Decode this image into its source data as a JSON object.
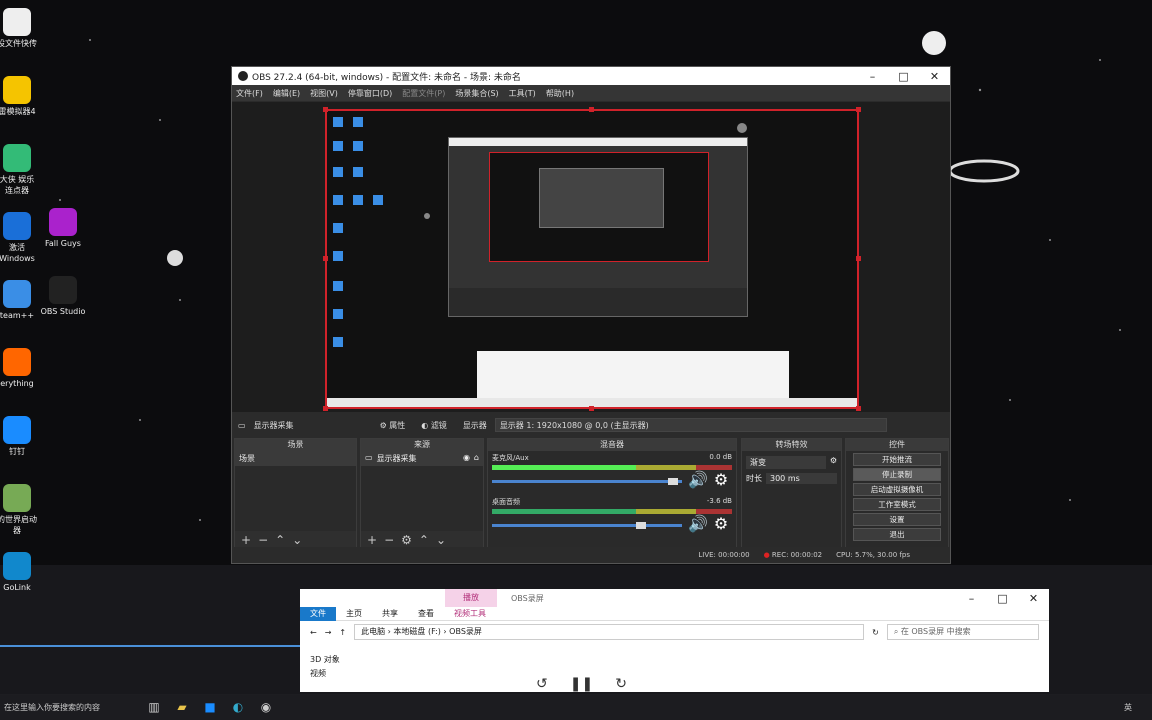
{
  "desktop_icons": [
    {
      "label": "设文件快传",
      "icon": "file-icon",
      "color": "#eee"
    },
    {
      "label": "雷模拟器4",
      "icon": "emulator-icon",
      "color": "#f5c400"
    },
    {
      "label": "大侠 娱乐\n连点器",
      "icon": "clicker-icon",
      "color": "#3b7"
    },
    {
      "label": "激活\nWindows",
      "icon": "zip-icon",
      "color": "#1a6fd8"
    },
    {
      "label": "team++",
      "icon": "gear-icon",
      "color": "#3a8ee6"
    },
    {
      "label": "erything",
      "icon": "search-icon",
      "color": "#f60"
    },
    {
      "label": "钉钉",
      "icon": "dingtalk-icon",
      "color": "#1a8cff"
    },
    {
      "label": "的世界启动\n器",
      "icon": "minecraft-icon",
      "color": "#7a5"
    },
    {
      "label": "GoLink",
      "icon": "golink-icon",
      "color": "#18c"
    }
  ],
  "desktop_icons2": [
    {
      "label": "Fall Guys",
      "icon": "fallguys-icon",
      "color": "#a2c"
    },
    {
      "label": "OBS Studio",
      "icon": "obs-icon",
      "color": "#222"
    }
  ],
  "obs": {
    "title": "OBS 27.2.4 (64-bit, windows) - 配置文件: 未命名 - 场景: 未命名",
    "menu": [
      "文件(F)",
      "编辑(E)",
      "视图(V)",
      "停靠窗口(D)",
      "配置文件(P)",
      "场景集合(S)",
      "工具(T)",
      "帮助(H)"
    ],
    "source_bar": {
      "name": "显示器采集",
      "properties": "属性",
      "filters": "滤镜",
      "display_label": "显示器",
      "display_value": "显示器 1: 1920x1080 @ 0,0 (主显示器)"
    },
    "docks": {
      "scenes": {
        "title": "场景",
        "items": [
          "场景"
        ]
      },
      "sources": {
        "title": "来源",
        "items": [
          "显示器采集"
        ]
      },
      "mixer": {
        "title": "混音器",
        "channels": [
          {
            "name": "麦克风/Aux",
            "db": "0.0 dB",
            "level": 0.6,
            "volume": 0.98
          },
          {
            "name": "桌面音频",
            "db": "-3.6 dB",
            "level": 0.0,
            "volume": 0.8
          }
        ]
      },
      "transitions": {
        "title": "转场特效",
        "type": "渐变",
        "duration_label": "时长",
        "duration": "300 ms"
      },
      "controls": {
        "title": "控件",
        "buttons": [
          "开始推流",
          "停止录制",
          "启动虚拟摄像机",
          "工作室模式",
          "设置",
          "退出"
        ]
      }
    },
    "status": {
      "live": "LIVE: 00:00:00",
      "rec": "REC: 00:00:02",
      "cpu": "CPU: 5.7%, 30.00 fps"
    }
  },
  "explorer": {
    "manage_tab": "播放",
    "title": "OBS录屏",
    "ribbon": [
      "文件",
      "主页",
      "共享",
      "查看",
      "视频工具"
    ],
    "path": [
      "此电脑",
      "本地磁盘 (F:)",
      "OBS录屏"
    ],
    "search_placeholder": "在 OBS录屏 中搜索",
    "nav": [
      "3D 对象",
      "视频"
    ]
  },
  "taskbar": {
    "search": "在这里输入你要搜索的内容",
    "lang": "英"
  }
}
